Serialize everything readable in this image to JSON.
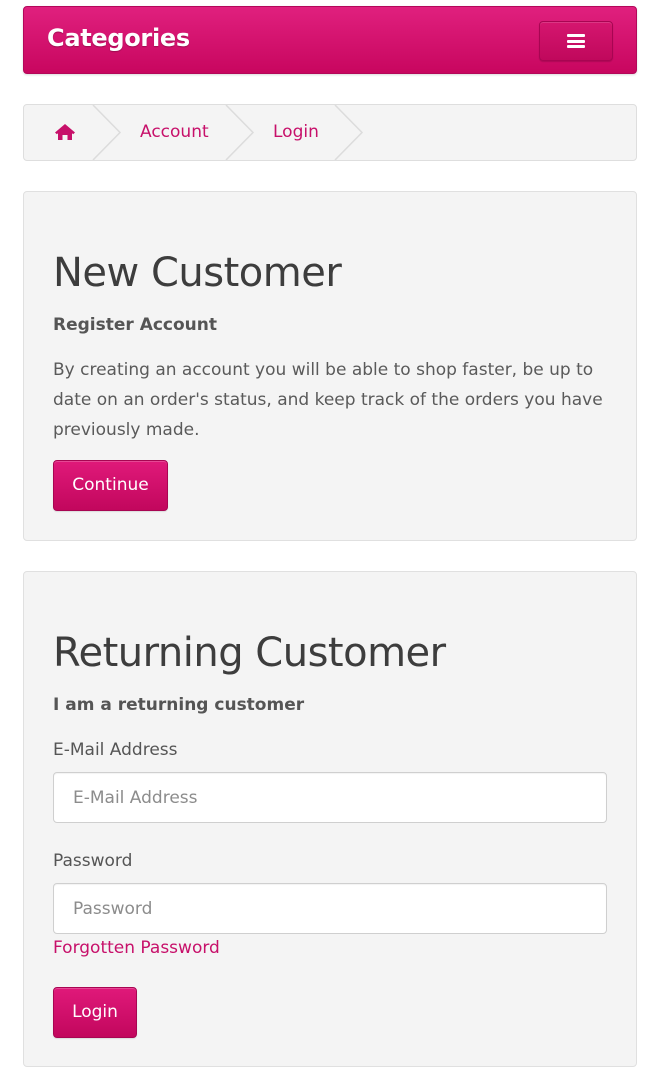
{
  "header": {
    "title": "Categories",
    "menu_icon": "hamburger-menu-icon",
    "accent_color": "#d0106a"
  },
  "breadcrumb": {
    "home_icon": "home-icon",
    "items": [
      {
        "label": "Account"
      },
      {
        "label": "Login"
      }
    ]
  },
  "new_customer": {
    "title": "New Customer",
    "subtitle": "Register Account",
    "description": "By creating an account you will be able to shop faster, be up to date on an order's status, and keep track of the orders you have previously made.",
    "button_label": "Continue"
  },
  "returning_customer": {
    "title": "Returning Customer",
    "subtitle": "I am a returning customer",
    "email": {
      "label": "E-Mail Address",
      "placeholder": "E-Mail Address",
      "value": ""
    },
    "password": {
      "label": "Password",
      "placeholder": "Password",
      "value": ""
    },
    "forgot_link": "Forgotten Password",
    "button_label": "Login"
  }
}
